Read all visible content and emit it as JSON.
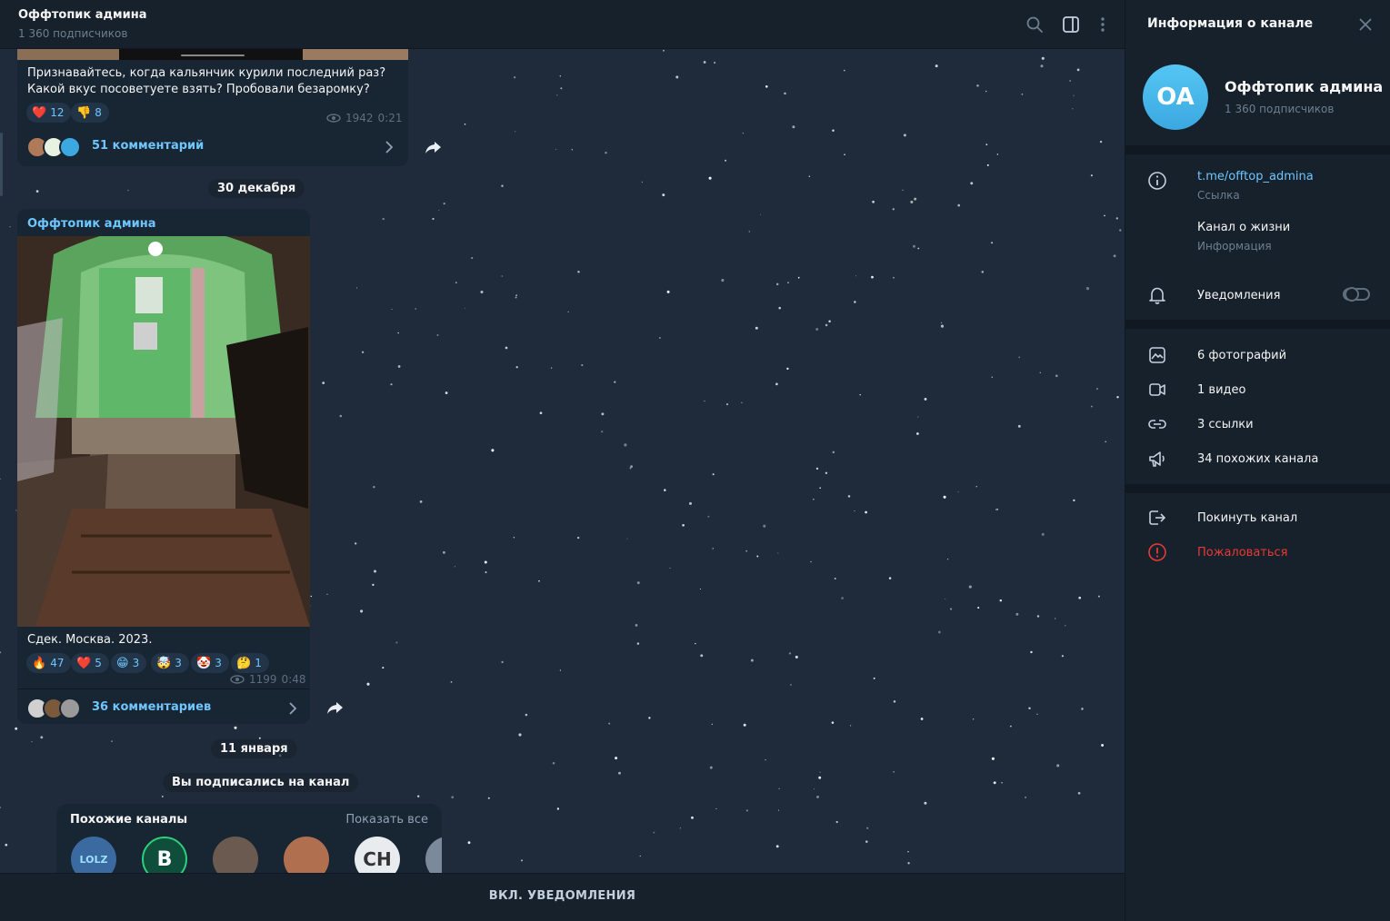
{
  "chat_header": {
    "title": "Оффтопик админа",
    "subscribers": "1 360 подписчиков"
  },
  "messages": [
    {
      "text": "Признавайтесь, когда кальянчик курили последний раз? Какой вкус посоветуете взять? Пробовали безаромку?",
      "reactions": [
        {
          "emoji": "❤️",
          "count": "12"
        },
        {
          "emoji": "👎",
          "count": "8"
        }
      ],
      "views": "1942",
      "time": "0:21",
      "comments": "51 комментарий"
    },
    {
      "date": "30 декабря",
      "sender": "Оффтопик админа",
      "caption": "Сдек. Москва. 2023.",
      "reactions": [
        {
          "emoji": "🔥",
          "count": "47"
        },
        {
          "emoji": "❤️",
          "count": "5"
        },
        {
          "emoji": "😁",
          "count": "3"
        },
        {
          "emoji": "🤯",
          "count": "3"
        },
        {
          "emoji": "🤡",
          "count": "3"
        },
        {
          "emoji": "🤔",
          "count": "1"
        }
      ],
      "views": "1199",
      "time": "0:48",
      "comments": "36 комментариев"
    }
  ],
  "service": {
    "date": "11 января",
    "subscribed": "Вы подписались на канал"
  },
  "similar": {
    "title": "Похожие каналы",
    "show_all": "Показать все",
    "channels": [
      {
        "label": "LOLZ"
      },
      {
        "label": "B"
      },
      {
        "label": ""
      },
      {
        "label": ""
      },
      {
        "label": "CH"
      },
      {
        "label": ""
      }
    ]
  },
  "bottom_bar": {
    "label": "ВКЛ. УВЕДОМЛЕНИЯ"
  },
  "panel": {
    "title": "Информация о канале",
    "avatar_initials": "OA",
    "name": "Оффтопик админа",
    "subscribers": "1 360 подписчиков",
    "link": "t.me/offtop_admina",
    "link_caption": "Ссылка",
    "description": "Канал о жизни",
    "description_caption": "Информация",
    "notifications": "Уведомления",
    "notifications_on": false,
    "media": {
      "photos": "6 фотографий",
      "videos": "1 видео",
      "links": "3 ссылки",
      "similar": "34 похожих канала"
    },
    "leave": "Покинуть канал",
    "report": "Пожаловаться"
  },
  "colors": {
    "accent": "#6ec6ff",
    "danger": "#e53935",
    "panel_bg": "#17212b",
    "bubble_bg": "#182533"
  }
}
